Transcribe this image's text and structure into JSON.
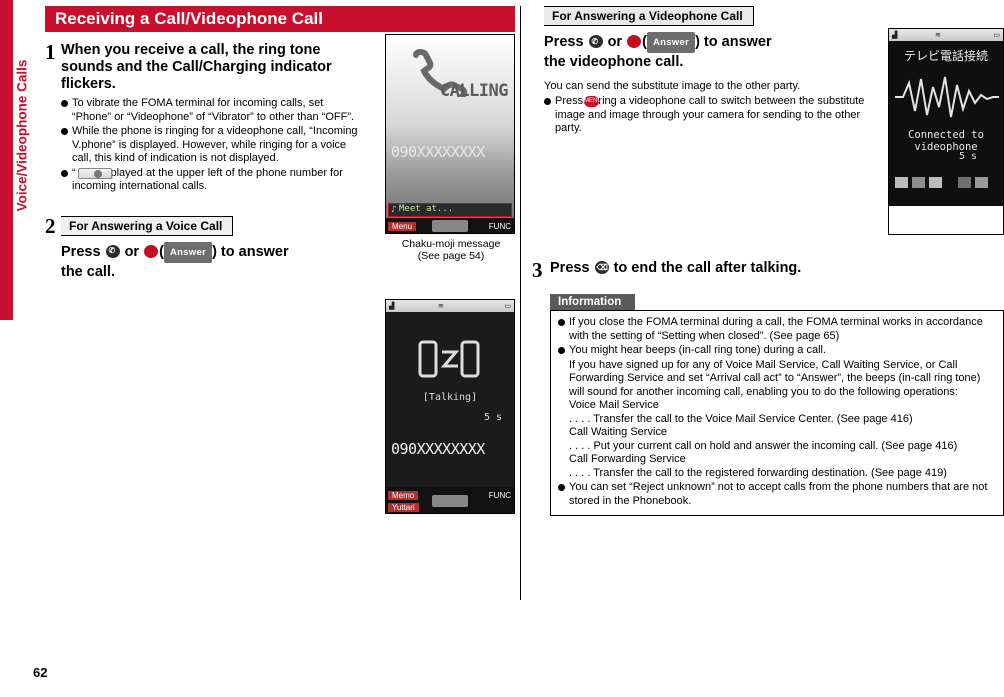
{
  "side_tab": {
    "label": "Voice/Videophone Calls"
  },
  "page_number": "62",
  "left": {
    "title": "Receiving a Call/Videophone Call",
    "step1": {
      "number": "1",
      "heading": "When you receive a call, the ring tone sounds and the Call/Charging indicator flickers.",
      "bullets": [
        "To vibrate the FOMA terminal for incoming calls, set “Phone” or “Videophone” of “Vibrator” to other than “OFF”.",
        "While the phone is ringing for a videophone call, “Incoming V.phone” is displayed. However, while ringing for a voice call, this kind of indication is not displayed.",
        "“        ” is displayed at the upper left of the phone number for incoming international calls."
      ]
    },
    "step2": {
      "number": "2",
      "subhead": "For Answering a Voice Call",
      "press_pre": "Press",
      "press_or": "or",
      "answer_label": "Answer",
      "press_post": ") to answer",
      "press_post2": "the call."
    },
    "shot1": {
      "caption_line1": "Chaku-moji message",
      "caption_line2": "(See page 54)",
      "screen_text_calling": "CALLING",
      "screen_number": "090XXXXXXXX",
      "chakumoji": "Meet at...",
      "softkey_left": "Menu",
      "softkey_right": "FUNC"
    },
    "shot2": {
      "screen_status": "[Talking]",
      "screen_timer": "5 s",
      "screen_number": "090XXXXXXXX",
      "softkey_left1": "Memo",
      "softkey_left2": "Yuttari",
      "softkey_right": "FUNC"
    }
  },
  "right": {
    "subhead": "For Answering a Videophone Call",
    "press_pre": "Press",
    "press_or": "or",
    "answer_label": "Answer",
    "press_post": ") to answer",
    "press_post2": "the videophone call.",
    "note": "You can send the substitute image to the other party.",
    "bullet1": "Press         during a videophone call to switch between the substitute image and image through your camera for sending to the other party.",
    "shot3": {
      "screen_title": "テレビ電話接続",
      "screen_status": "Connected to videophone",
      "screen_timer": "5 s"
    },
    "step3": {
      "number": "3",
      "heading_pre": "Press",
      "heading_post": "to end the call after talking."
    },
    "information": {
      "title": "Information",
      "items": [
        "If you close the FOMA terminal during a call, the FOMA terminal works in accordance with the setting of “Setting when closed”. (See page 65)",
        "You might hear beeps (in-call ring tone) during a call."
      ],
      "sub_lines": [
        "If you have signed up for any of Voice Mail Service, Call Waiting Service, or Call Forwarding Service and set “Arrival call act” to “Answer”, the beeps (in-call ring tone) will sound for another incoming call, enabling you to do the following operations:",
        "Voice Mail Service",
        ". . . . Transfer the call to the Voice Mail Service Center. (See page 416)",
        "Call Waiting Service",
        ". . . . Put your current call on hold and answer the incoming call. (See page 416)",
        "Call Forwarding Service",
        ". . . . Transfer the call to the registered forwarding destination. (See page 419)"
      ],
      "last_item": "You can set “Reject unknown” not to accept calls from the phone numbers that are not stored in the Phonebook."
    }
  },
  "colors": {
    "brand_red": "#c8102e",
    "info_head_gray": "#5a5a5a"
  }
}
